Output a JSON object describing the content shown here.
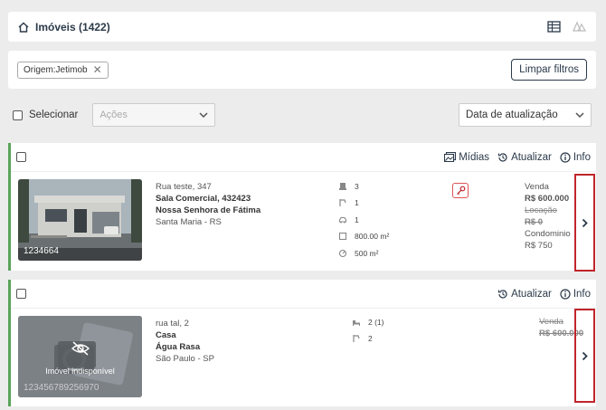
{
  "header": {
    "title": "Imóveis (1422)",
    "icons": [
      "home-icon",
      "table-icon",
      "map-icon"
    ]
  },
  "filters": {
    "chip_label": "Origem:Jetimob",
    "clear_label": "Limpar filtros"
  },
  "selection": {
    "select_label": "Selecionar",
    "actions_placeholder": "Ações",
    "sort_value": "Data de atualização"
  },
  "listings": [
    {
      "tools": {
        "media": "Mídias",
        "update": "Atualizar",
        "info": "Info"
      },
      "code": "1234664",
      "street": "Rua teste, 347",
      "type_line": "Sala Comercial, 432423",
      "neighborhood": "Nossa Senhora de Fátima",
      "city": "Santa Maria - RS",
      "features": [
        "3",
        "1",
        "1",
        "800.00 m²",
        "500 m²"
      ],
      "prices": {
        "sale_label": "Venda",
        "sale_value": "R$ 600.000",
        "rent_label": "Locação",
        "rent_value": "R$ 0",
        "condo_label": "Condominio",
        "condo_value": "R$ 750"
      }
    },
    {
      "tools": {
        "update": "Atualizar",
        "info": "Info"
      },
      "code": "123456789256970",
      "unavailable_label": "Imóvel indisponível",
      "street": "rua tal, 2",
      "type_line": "Casa",
      "neighborhood": "Água Rasa",
      "city": "São Paulo - SP",
      "features": [
        "2 (1)",
        "2"
      ],
      "prices": {
        "sale_label": "Venda",
        "sale_value": "R$ 600.000"
      }
    }
  ],
  "colors": {
    "accent_green": "#5aa35a",
    "highlight_red": "#c0252b",
    "navy": "#2b3a4a"
  }
}
